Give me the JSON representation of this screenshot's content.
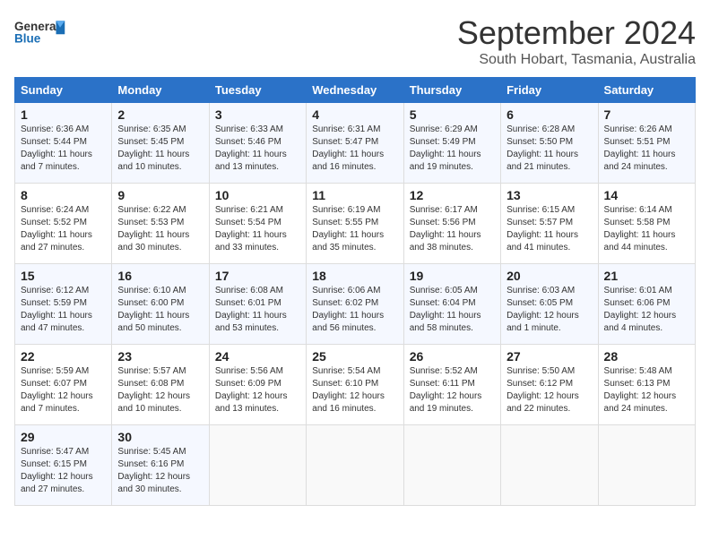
{
  "header": {
    "logo_general": "General",
    "logo_blue": "Blue",
    "month_title": "September 2024",
    "subtitle": "South Hobart, Tasmania, Australia"
  },
  "calendar": {
    "days_of_week": [
      "Sunday",
      "Monday",
      "Tuesday",
      "Wednesday",
      "Thursday",
      "Friday",
      "Saturday"
    ],
    "weeks": [
      [
        {
          "day": "",
          "sunrise": "",
          "sunset": "",
          "daylight": ""
        },
        {
          "day": "2",
          "sunrise": "Sunrise: 6:35 AM",
          "sunset": "Sunset: 5:45 PM",
          "daylight": "Daylight: 11 hours and 10 minutes."
        },
        {
          "day": "3",
          "sunrise": "Sunrise: 6:33 AM",
          "sunset": "Sunset: 5:46 PM",
          "daylight": "Daylight: 11 hours and 13 minutes."
        },
        {
          "day": "4",
          "sunrise": "Sunrise: 6:31 AM",
          "sunset": "Sunset: 5:47 PM",
          "daylight": "Daylight: 11 hours and 16 minutes."
        },
        {
          "day": "5",
          "sunrise": "Sunrise: 6:29 AM",
          "sunset": "Sunset: 5:49 PM",
          "daylight": "Daylight: 11 hours and 19 minutes."
        },
        {
          "day": "6",
          "sunrise": "Sunrise: 6:28 AM",
          "sunset": "Sunset: 5:50 PM",
          "daylight": "Daylight: 11 hours and 21 minutes."
        },
        {
          "day": "7",
          "sunrise": "Sunrise: 6:26 AM",
          "sunset": "Sunset: 5:51 PM",
          "daylight": "Daylight: 11 hours and 24 minutes."
        }
      ],
      [
        {
          "day": "8",
          "sunrise": "Sunrise: 6:24 AM",
          "sunset": "Sunset: 5:52 PM",
          "daylight": "Daylight: 11 hours and 27 minutes."
        },
        {
          "day": "9",
          "sunrise": "Sunrise: 6:22 AM",
          "sunset": "Sunset: 5:53 PM",
          "daylight": "Daylight: 11 hours and 30 minutes."
        },
        {
          "day": "10",
          "sunrise": "Sunrise: 6:21 AM",
          "sunset": "Sunset: 5:54 PM",
          "daylight": "Daylight: 11 hours and 33 minutes."
        },
        {
          "day": "11",
          "sunrise": "Sunrise: 6:19 AM",
          "sunset": "Sunset: 5:55 PM",
          "daylight": "Daylight: 11 hours and 35 minutes."
        },
        {
          "day": "12",
          "sunrise": "Sunrise: 6:17 AM",
          "sunset": "Sunset: 5:56 PM",
          "daylight": "Daylight: 11 hours and 38 minutes."
        },
        {
          "day": "13",
          "sunrise": "Sunrise: 6:15 AM",
          "sunset": "Sunset: 5:57 PM",
          "daylight": "Daylight: 11 hours and 41 minutes."
        },
        {
          "day": "14",
          "sunrise": "Sunrise: 6:14 AM",
          "sunset": "Sunset: 5:58 PM",
          "daylight": "Daylight: 11 hours and 44 minutes."
        }
      ],
      [
        {
          "day": "15",
          "sunrise": "Sunrise: 6:12 AM",
          "sunset": "Sunset: 5:59 PM",
          "daylight": "Daylight: 11 hours and 47 minutes."
        },
        {
          "day": "16",
          "sunrise": "Sunrise: 6:10 AM",
          "sunset": "Sunset: 6:00 PM",
          "daylight": "Daylight: 11 hours and 50 minutes."
        },
        {
          "day": "17",
          "sunrise": "Sunrise: 6:08 AM",
          "sunset": "Sunset: 6:01 PM",
          "daylight": "Daylight: 11 hours and 53 minutes."
        },
        {
          "day": "18",
          "sunrise": "Sunrise: 6:06 AM",
          "sunset": "Sunset: 6:02 PM",
          "daylight": "Daylight: 11 hours and 56 minutes."
        },
        {
          "day": "19",
          "sunrise": "Sunrise: 6:05 AM",
          "sunset": "Sunset: 6:04 PM",
          "daylight": "Daylight: 11 hours and 58 minutes."
        },
        {
          "day": "20",
          "sunrise": "Sunrise: 6:03 AM",
          "sunset": "Sunset: 6:05 PM",
          "daylight": "Daylight: 12 hours and 1 minute."
        },
        {
          "day": "21",
          "sunrise": "Sunrise: 6:01 AM",
          "sunset": "Sunset: 6:06 PM",
          "daylight": "Daylight: 12 hours and 4 minutes."
        }
      ],
      [
        {
          "day": "22",
          "sunrise": "Sunrise: 5:59 AM",
          "sunset": "Sunset: 6:07 PM",
          "daylight": "Daylight: 12 hours and 7 minutes."
        },
        {
          "day": "23",
          "sunrise": "Sunrise: 5:57 AM",
          "sunset": "Sunset: 6:08 PM",
          "daylight": "Daylight: 12 hours and 10 minutes."
        },
        {
          "day": "24",
          "sunrise": "Sunrise: 5:56 AM",
          "sunset": "Sunset: 6:09 PM",
          "daylight": "Daylight: 12 hours and 13 minutes."
        },
        {
          "day": "25",
          "sunrise": "Sunrise: 5:54 AM",
          "sunset": "Sunset: 6:10 PM",
          "daylight": "Daylight: 12 hours and 16 minutes."
        },
        {
          "day": "26",
          "sunrise": "Sunrise: 5:52 AM",
          "sunset": "Sunset: 6:11 PM",
          "daylight": "Daylight: 12 hours and 19 minutes."
        },
        {
          "day": "27",
          "sunrise": "Sunrise: 5:50 AM",
          "sunset": "Sunset: 6:12 PM",
          "daylight": "Daylight: 12 hours and 22 minutes."
        },
        {
          "day": "28",
          "sunrise": "Sunrise: 5:48 AM",
          "sunset": "Sunset: 6:13 PM",
          "daylight": "Daylight: 12 hours and 24 minutes."
        }
      ],
      [
        {
          "day": "29",
          "sunrise": "Sunrise: 5:47 AM",
          "sunset": "Sunset: 6:15 PM",
          "daylight": "Daylight: 12 hours and 27 minutes."
        },
        {
          "day": "30",
          "sunrise": "Sunrise: 5:45 AM",
          "sunset": "Sunset: 6:16 PM",
          "daylight": "Daylight: 12 hours and 30 minutes."
        },
        {
          "day": "",
          "sunrise": "",
          "sunset": "",
          "daylight": ""
        },
        {
          "day": "",
          "sunrise": "",
          "sunset": "",
          "daylight": ""
        },
        {
          "day": "",
          "sunrise": "",
          "sunset": "",
          "daylight": ""
        },
        {
          "day": "",
          "sunrise": "",
          "sunset": "",
          "daylight": ""
        },
        {
          "day": "",
          "sunrise": "",
          "sunset": "",
          "daylight": ""
        }
      ]
    ],
    "first_week_first_day": {
      "day": "1",
      "sunrise": "Sunrise: 6:36 AM",
      "sunset": "Sunset: 5:44 PM",
      "daylight": "Daylight: 11 hours and 7 minutes."
    }
  }
}
